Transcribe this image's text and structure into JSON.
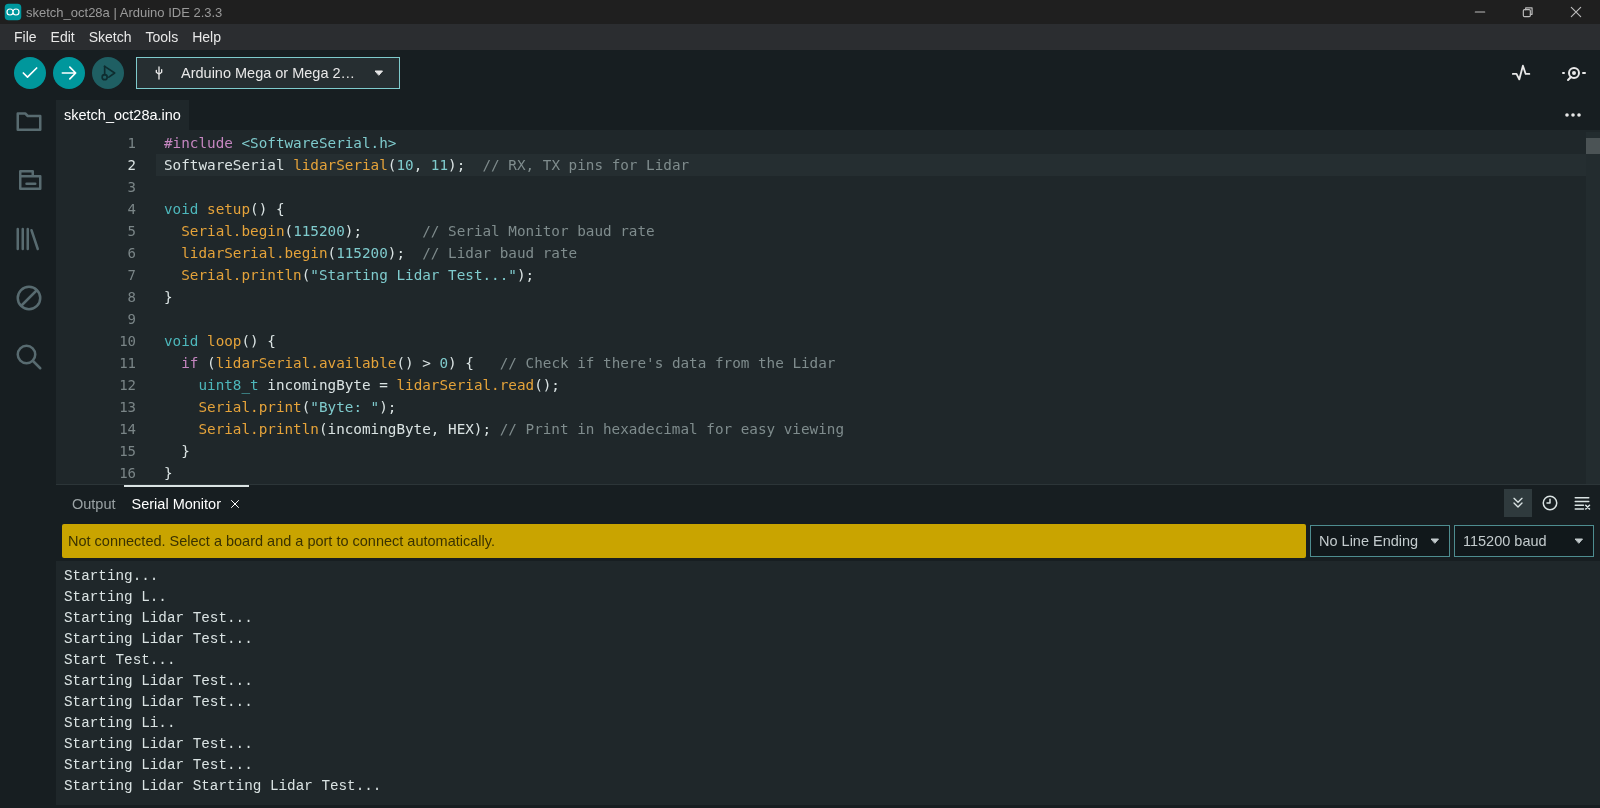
{
  "window": {
    "title": "sketch_oct28a | Arduino IDE 2.3.3"
  },
  "menu": [
    "File",
    "Edit",
    "Sketch",
    "Tools",
    "Help"
  ],
  "toolbar": {
    "board": "Arduino Mega or Mega 2…",
    "debug_disabled": true
  },
  "sidebar": {
    "items": [
      {
        "selected": false
      },
      {
        "selected": false
      },
      {
        "selected": false
      },
      {
        "selected": false
      },
      {
        "selected": false
      }
    ]
  },
  "editor_tabs": [
    {
      "label": "sketch_oct28a.ino",
      "selected": true
    }
  ],
  "code": [
    {
      "number": "1",
      "highlighted": false,
      "tokens": [
        {
          "kind": "preproc",
          "text": "#include "
        },
        {
          "kind": "string",
          "text": "<SoftwareSerial.h>"
        }
      ]
    },
    {
      "number": "2",
      "highlighted": true,
      "tokens": [
        {
          "kind": "plain",
          "text": "SoftwareSerial "
        },
        {
          "kind": "func",
          "text": "lidarSerial"
        },
        {
          "kind": "plain",
          "text": "("
        },
        {
          "kind": "number",
          "text": "10"
        },
        {
          "kind": "plain",
          "text": ", "
        },
        {
          "kind": "number",
          "text": "11"
        },
        {
          "kind": "plain",
          "text": ");  "
        },
        {
          "kind": "comment",
          "text": "// RX, TX pins for Lidar"
        }
      ]
    },
    {
      "number": "3",
      "highlighted": false
    },
    {
      "number": "4",
      "highlighted": false,
      "tokens": [
        {
          "kind": "type",
          "text": "void "
        },
        {
          "kind": "func",
          "text": "setup"
        },
        {
          "kind": "plain",
          "text": "() {"
        }
      ]
    },
    {
      "number": "5",
      "highlighted": false,
      "tokens": [
        {
          "kind": "func",
          "text": "  Serial.begin"
        },
        {
          "kind": "plain",
          "text": "("
        },
        {
          "kind": "number",
          "text": "115200"
        },
        {
          "kind": "plain",
          "text": ");       "
        },
        {
          "kind": "comment",
          "text": "// Serial Monitor baud rate"
        }
      ]
    },
    {
      "number": "6",
      "highlighted": false,
      "tokens": [
        {
          "kind": "func",
          "text": "  lidarSerial.begin"
        },
        {
          "kind": "plain",
          "text": "("
        },
        {
          "kind": "number",
          "text": "115200"
        },
        {
          "kind": "plain",
          "text": ");  "
        },
        {
          "kind": "comment",
          "text": "// Lidar baud rate"
        }
      ]
    },
    {
      "number": "7",
      "highlighted": false,
      "tokens": [
        {
          "kind": "func",
          "text": "  Serial.println"
        },
        {
          "kind": "plain",
          "text": "("
        },
        {
          "kind": "string",
          "text": "\"Starting Lidar Test...\""
        },
        {
          "kind": "plain",
          "text": ");"
        }
      ]
    },
    {
      "number": "8",
      "highlighted": false,
      "tokens": [
        {
          "kind": "plain",
          "text": "}"
        }
      ]
    },
    {
      "number": "9",
      "highlighted": false
    },
    {
      "number": "10",
      "highlighted": false,
      "tokens": [
        {
          "kind": "type",
          "text": "void "
        },
        {
          "kind": "func",
          "text": "loop"
        },
        {
          "kind": "plain",
          "text": "() {"
        }
      ]
    },
    {
      "number": "11",
      "highlighted": false,
      "tokens": [
        {
          "kind": "preproc",
          "text": "  if "
        },
        {
          "kind": "plain",
          "text": "("
        },
        {
          "kind": "func",
          "text": "lidarSerial.available"
        },
        {
          "kind": "plain",
          "text": "() > "
        },
        {
          "kind": "number",
          "text": "0"
        },
        {
          "kind": "plain",
          "text": ") {   "
        },
        {
          "kind": "comment",
          "text": "// Check if there's data from the Lidar"
        }
      ]
    },
    {
      "number": "12",
      "highlighted": false,
      "tokens": [
        {
          "kind": "type",
          "text": "    uint8_t"
        },
        {
          "kind": "plain",
          "text": " incomingByte = "
        },
        {
          "kind": "func",
          "text": "lidarSerial.read"
        },
        {
          "kind": "plain",
          "text": "();"
        }
      ]
    },
    {
      "number": "13",
      "highlighted": false,
      "tokens": [
        {
          "kind": "func",
          "text": "    Serial.print"
        },
        {
          "kind": "plain",
          "text": "("
        },
        {
          "kind": "string",
          "text": "\"Byte: \""
        },
        {
          "kind": "plain",
          "text": ");"
        }
      ]
    },
    {
      "number": "14",
      "highlighted": false,
      "tokens": [
        {
          "kind": "func",
          "text": "    Serial.println"
        },
        {
          "kind": "plain",
          "text": "(incomingByte, HEX); "
        },
        {
          "kind": "comment",
          "text": "// Print in hexadecimal for easy viewing"
        }
      ]
    },
    {
      "number": "15",
      "highlighted": false,
      "tokens": [
        {
          "kind": "plain",
          "text": "  }"
        }
      ]
    },
    {
      "number": "16",
      "highlighted": false,
      "tokens": [
        {
          "kind": "plain",
          "text": "}"
        }
      ]
    }
  ],
  "panel_tabs": [
    {
      "label": "Output",
      "selected": false,
      "closable": false
    },
    {
      "label": "Serial Monitor",
      "selected": true,
      "closable": true
    }
  ],
  "panel_tools": {
    "autoscroll": true,
    "timestamp": false
  },
  "banner": "Not connected. Select a board and a port to connect automatically.",
  "line_ending": "No Line Ending",
  "baud": "115200 baud",
  "serial_output": [
    "Starting...",
    "Starting L..",
    "Starting Lidar Test...",
    "Starting Lidar Test...",
    "Start Test...",
    "Starting Lidar Test...",
    "Starting Lidar Test...",
    "Starting Li..",
    "Starting Lidar Test...",
    "Starting Lidar Test...",
    "Starting Lidar Starting Lidar Test..."
  ]
}
